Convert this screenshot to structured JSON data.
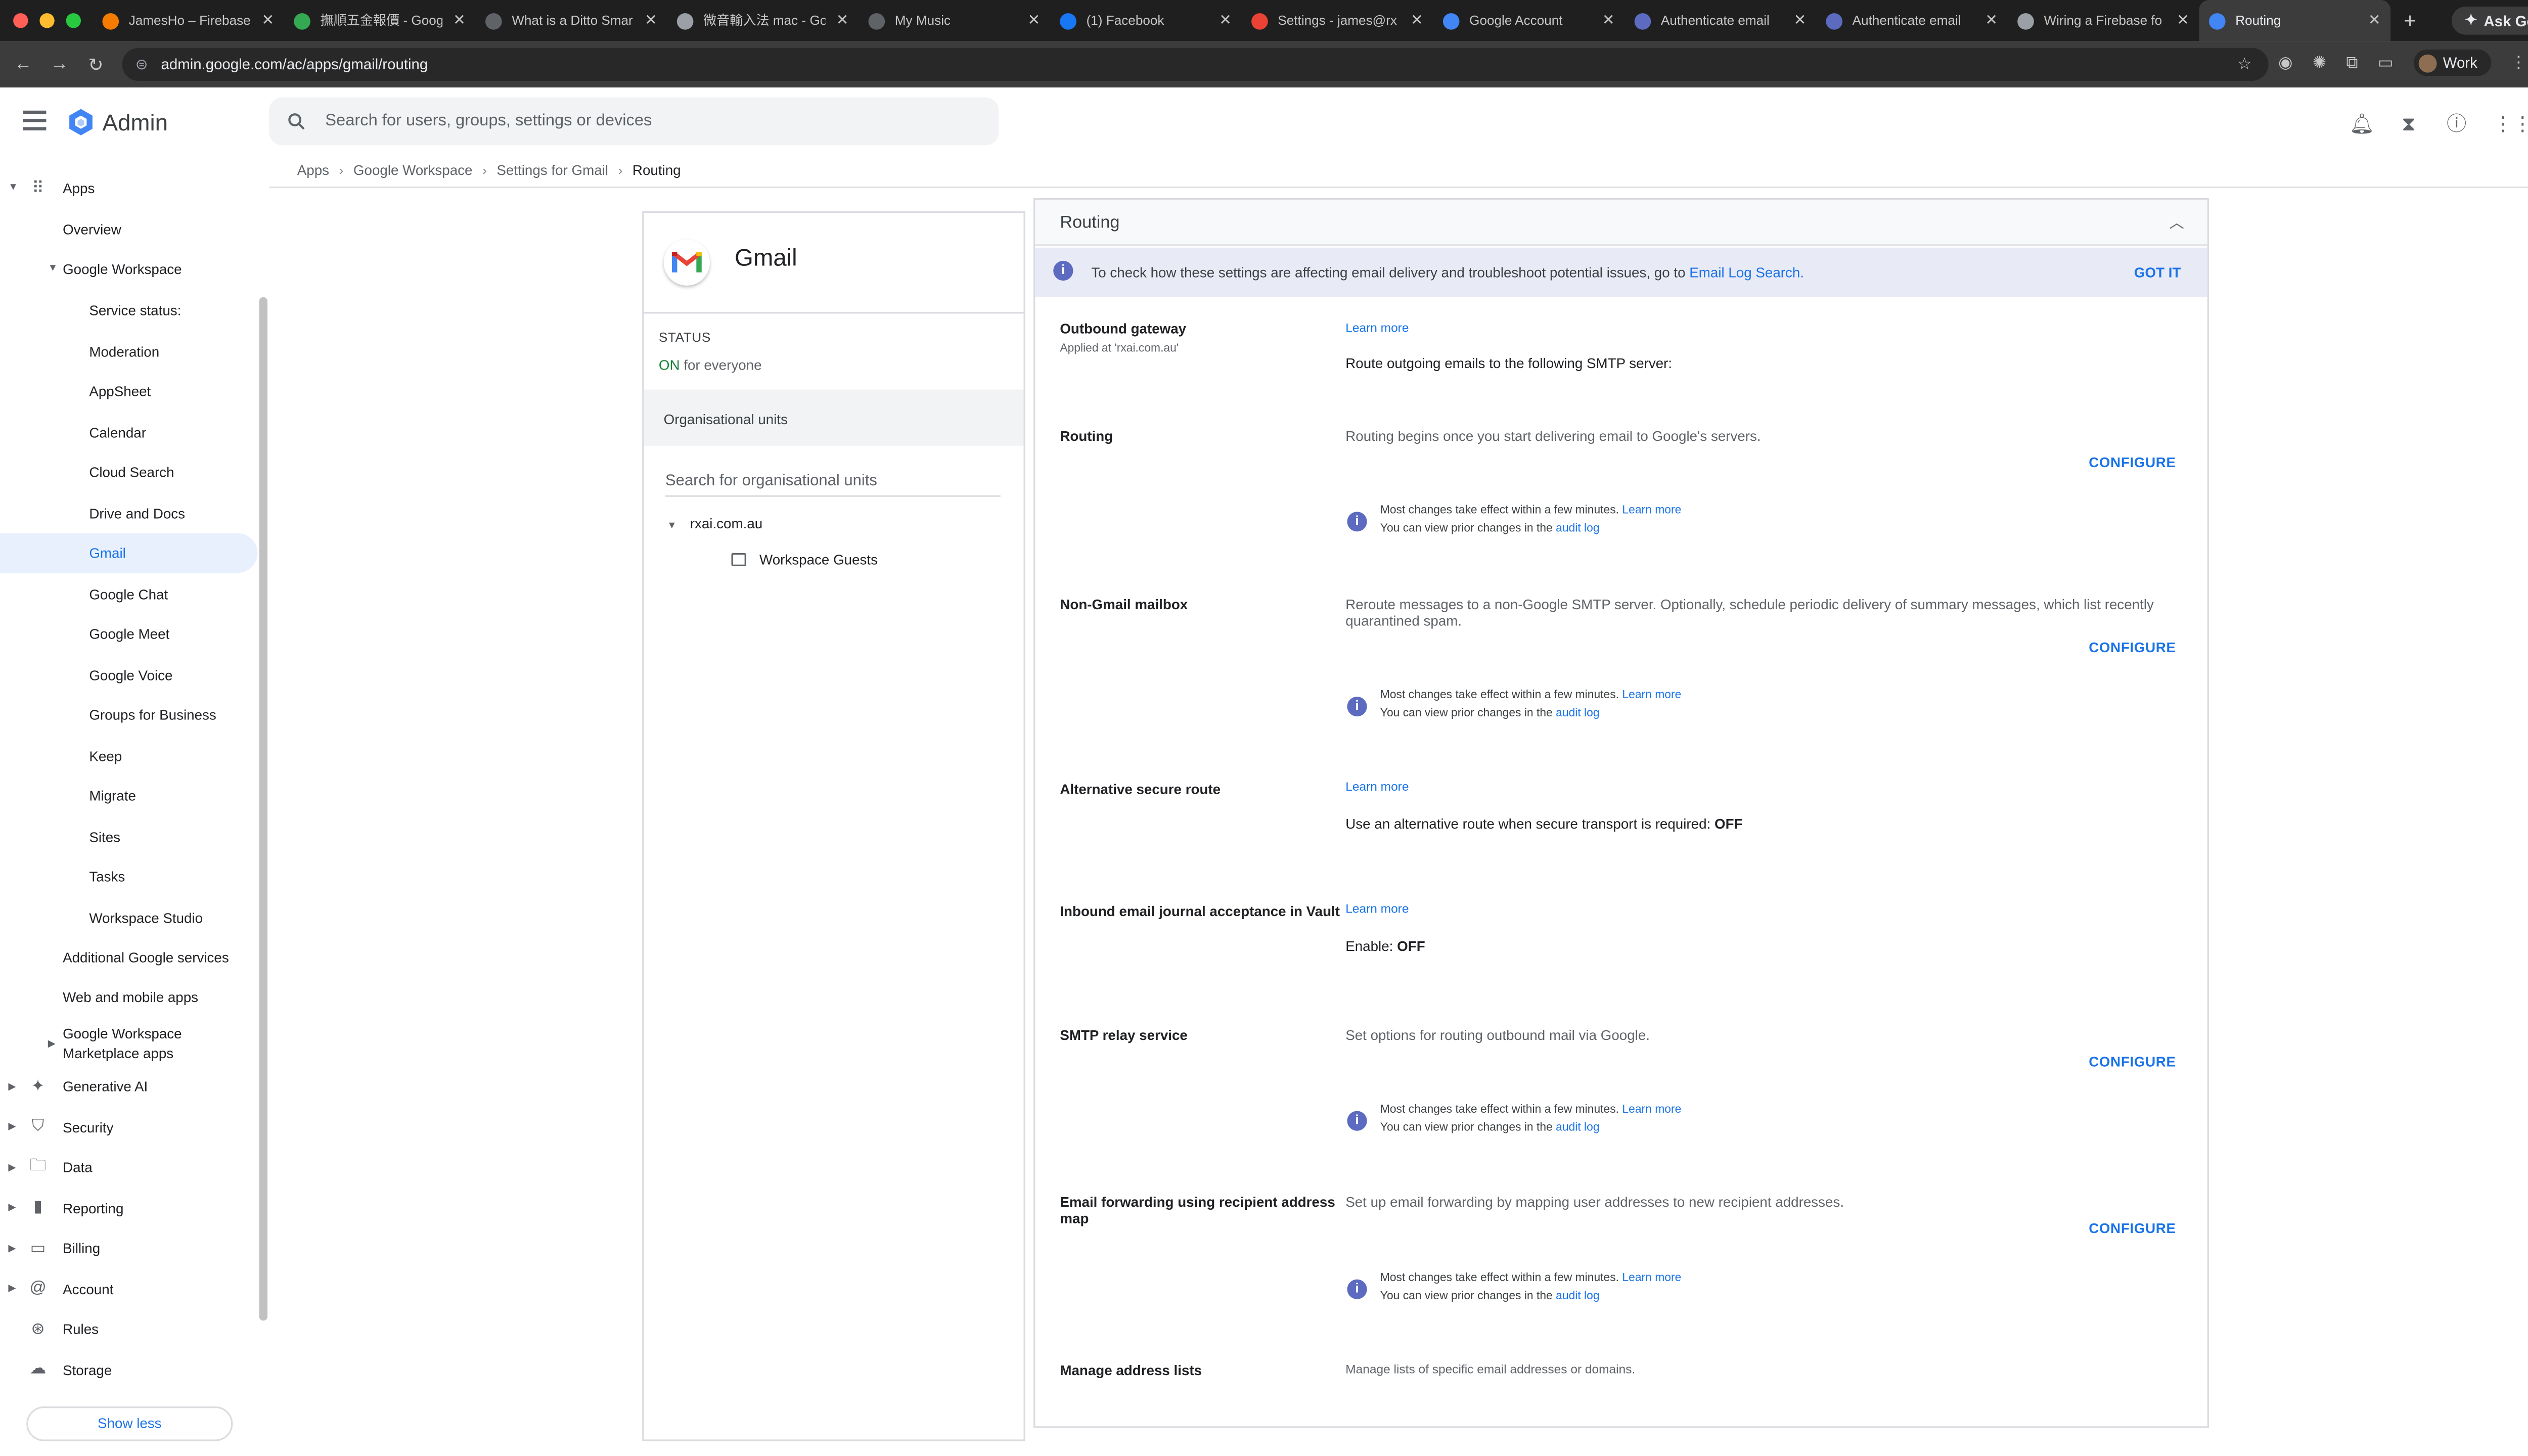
{
  "browser": {
    "tabs": [
      {
        "title": "JamesHo – Firebase",
        "color": "#f57c00"
      },
      {
        "title": "撫順五金報價 - Goog",
        "color": "#34a853"
      },
      {
        "title": "What is a Ditto Smar",
        "color": "#5f6368"
      },
      {
        "title": "微音輸入法 mac - Go",
        "color": "#9aa0a6"
      },
      {
        "title": "My Music",
        "color": "#5f6368"
      },
      {
        "title": "(1) Facebook",
        "color": "#1877f2"
      },
      {
        "title": "Settings - james@rx",
        "color": "#ea4335"
      },
      {
        "title": "Google Account",
        "color": "#4285f4"
      },
      {
        "title": "Authenticate email",
        "color": "#5c6bc0"
      },
      {
        "title": "Authenticate email",
        "color": "#5c6bc0"
      },
      {
        "title": "Wiring a Firebase fo",
        "color": "#9aa0a6"
      },
      {
        "title": "Routing",
        "color": "#4285f4"
      }
    ],
    "new_tab": "+",
    "gemini": "Ask Gemini",
    "url": "admin.google.com/ac/apps/gmail/routing",
    "profile": "Work"
  },
  "header": {
    "brand": "Admin",
    "search_placeholder": "Search for users, groups, settings or devices"
  },
  "breadcrumbs": [
    "Apps",
    "Google Workspace",
    "Settings for Gmail",
    "Routing"
  ],
  "sidebar": {
    "apps": "Apps",
    "overview": "Overview",
    "workspace": "Google Workspace",
    "workspace_items": [
      "Service status:",
      "Moderation",
      "AppSheet",
      "Calendar",
      "Cloud Search",
      "Drive and Docs",
      "Gmail",
      "Google Chat",
      "Google Meet",
      "Google Voice",
      "Groups for Business",
      "Keep",
      "Migrate",
      "Sites",
      "Tasks",
      "Workspace Studio"
    ],
    "additional": "Additional Google services",
    "web_mobile": "Web and mobile apps",
    "marketplace_1": "Google Workspace",
    "marketplace_2": "Marketplace apps",
    "top_level": [
      "Generative AI",
      "Security",
      "Data",
      "Reporting",
      "Billing",
      "Account",
      "Rules",
      "Storage"
    ],
    "show_less": "Show less"
  },
  "app_card": {
    "title": "Gmail",
    "status_label": "STATUS",
    "status_on": "ON",
    "status_rest": "for everyone",
    "ou_header": "Organisational units",
    "ou_search": "Search for organisational units",
    "ou_root": "rxai.com.au",
    "ou_child": "Workspace Guests"
  },
  "panel": {
    "title": "Routing",
    "banner_text": "To check how these settings are affecting email delivery and troubleshoot potential issues, go to",
    "banner_link": "Email Log Search.",
    "got_it": "GOT IT",
    "learn_more": "Learn more",
    "configure": "CONFIGURE",
    "note_line1": "Most changes take effect within a few minutes.",
    "note_line2": "You can view prior changes in the",
    "audit_log": "audit log",
    "sections": {
      "outbound": {
        "title": "Outbound gateway",
        "sub": "Applied at 'rxai.com.au'",
        "value": "Route outgoing emails to the following SMTP server:"
      },
      "routing": {
        "title": "Routing",
        "desc": "Routing begins once you start delivering email to Google's servers."
      },
      "nongmail": {
        "title": "Non-Gmail mailbox",
        "desc": "Reroute messages to a non-Google SMTP server. Optionally, schedule periodic delivery of summary messages, which list recently quarantined spam."
      },
      "altroute": {
        "title": "Alternative secure route",
        "value": "Use an alternative route when secure transport is required:",
        "state": "OFF"
      },
      "journal": {
        "title": "Inbound email journal acceptance in Vault",
        "value": "Enable:",
        "state": "OFF"
      },
      "smtp": {
        "title": "SMTP relay service",
        "desc": "Set options for routing outbound mail via Google."
      },
      "forwarding": {
        "title": "Email forwarding using recipient address map",
        "desc": "Set up email forwarding by mapping user addresses to new recipient addresses."
      },
      "addresslists": {
        "title": "Manage address lists",
        "desc": "Manage lists of specific email addresses or domains."
      }
    }
  }
}
